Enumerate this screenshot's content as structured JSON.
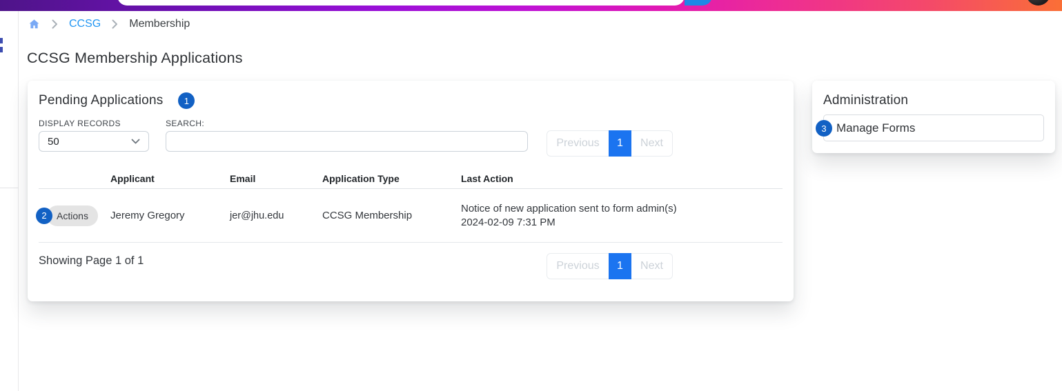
{
  "topbar": {
    "search_value": ""
  },
  "breadcrumb": {
    "link": "CCSG",
    "current": "Membership"
  },
  "page": {
    "title": "CCSG Membership Applications"
  },
  "main_card": {
    "title": "Pending Applications",
    "annotation_badge": "1",
    "display_records_label": "DISPLAY RECORDS",
    "display_records_value": "50",
    "search_label": "SEARCH:",
    "search_value": "",
    "pagination": {
      "previous": "Previous",
      "page": "1",
      "next": "Next"
    },
    "table": {
      "columns": [
        "",
        "Applicant",
        "Email",
        "Application Type",
        "Last Action"
      ],
      "rows": [
        {
          "annotation_badge": "2",
          "actions_label": "Actions",
          "applicant": "Jeremy Gregory",
          "email": "jer@jhu.edu",
          "application_type": "CCSG Membership",
          "last_action_line1": "Notice of new application sent to form admin(s)",
          "last_action_line2": "2024-02-09 7:31 PM"
        }
      ]
    },
    "footer": {
      "showing": "Showing Page 1 of 1"
    }
  },
  "admin_card": {
    "title": "Administration",
    "items": [
      {
        "annotation_badge": "3",
        "label": "Manage Forms"
      }
    ]
  },
  "colors": {
    "accent_blue": "#1b74f0",
    "badge_blue": "#1261c4",
    "link_blue": "#2196f3",
    "topbar_gradient_start": "#4e1489",
    "topbar_gradient_mid": "#e018b4",
    "topbar_gradient_end": "#fa6f36",
    "search_button_blue": "#1e88e5"
  }
}
